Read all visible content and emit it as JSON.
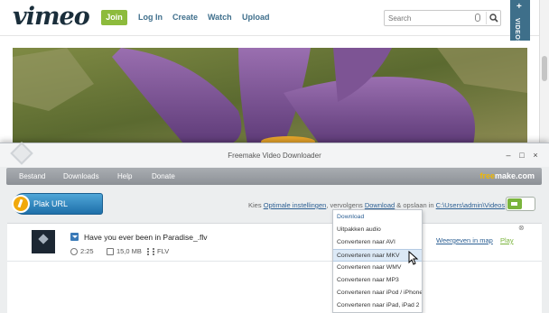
{
  "vimeo": {
    "logo": "vimeo",
    "join": "Join",
    "nav": [
      "Log In",
      "Create",
      "Watch",
      "Upload"
    ],
    "search_placeholder": "Search",
    "videos_tab_plus": "+",
    "videos_tab": "VIDEOS"
  },
  "freemake": {
    "title": "Freemake Video Downloader",
    "menu": [
      "Bestand",
      "Downloads",
      "Help",
      "Donate"
    ],
    "brand_free": "free",
    "brand_rest": "make.com",
    "plak_url": "Plak URL",
    "settings": {
      "kies": "Kies",
      "optimale": "Optimale instellingen",
      "vervolgens": ", vervolgens",
      "download": "Download",
      "opslaan": "& opslaan in",
      "path": "C:\\Users\\admin\\Videos"
    },
    "item": {
      "title": "Have you ever been in Paradise_.flv",
      "duration": "2:25",
      "size": "15,0 MB",
      "format": "FLV",
      "show_in_folder": "Weergeven in map",
      "play": "Play",
      "close": "⊗"
    },
    "dropdown": {
      "options": [
        "Download",
        "Uitpakken audio",
        "Converteren naar AVI",
        "Converteren naar MKV",
        "Converteren naar WMV",
        "Converteren naar MP3",
        "Converteren naar iPod / iPhone",
        "Converteren naar iPad, iPad 2"
      ],
      "highlighted_index": 3
    }
  },
  "colors": {
    "vimeo_green": "#8dbb3c",
    "vimeo_blue": "#3e6f8a",
    "freemake_blue": "#1e6fa9",
    "link_blue": "#2c5f93",
    "play_green": "#7ab43c"
  }
}
